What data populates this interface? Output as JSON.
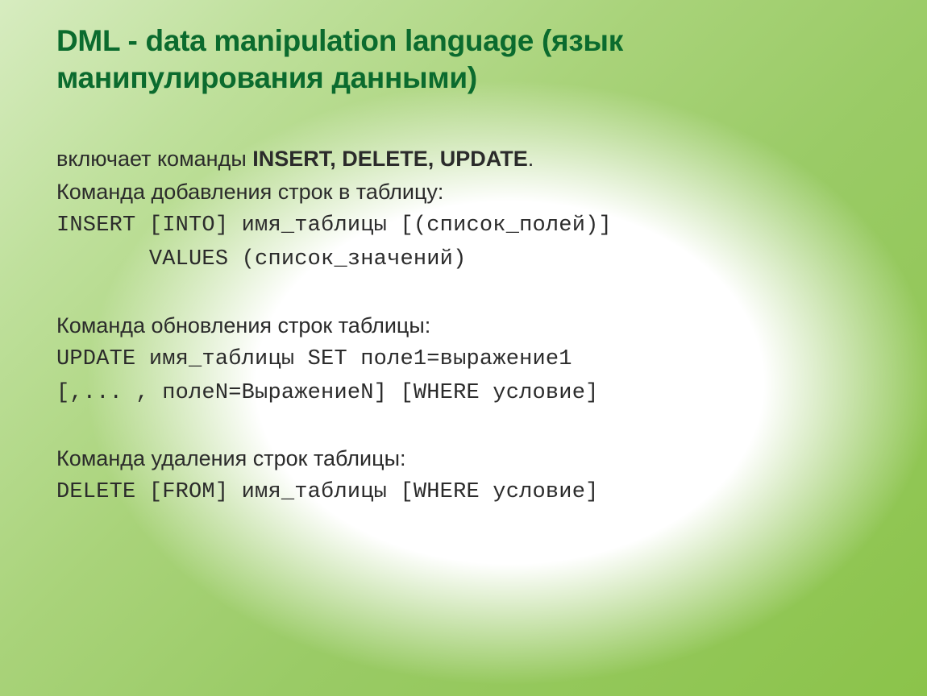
{
  "title": "DML - data manipulation language (язык манипулирования данными)",
  "intro": {
    "label": "включает команды ",
    "commands": "INSERT, DELETE, UPDATE",
    "tail": "."
  },
  "sections": {
    "insert": {
      "caption": "Команда добавления строк в таблицу:",
      "code": "INSERT [INTO] имя_таблицы [(список_полей)]\n       VALUES (список_значений)"
    },
    "update": {
      "caption": "Команда обновления строк таблицы:",
      "code": "UPDATE имя_таблицы SET поле1=выражение1\n[,... , полеN=ВыражениеN] [WHERE условие]"
    },
    "delete": {
      "caption": "Команда удаления строк таблицы:",
      "code": "DELETE [FROM] имя_таблицы [WHERE условие]"
    }
  }
}
